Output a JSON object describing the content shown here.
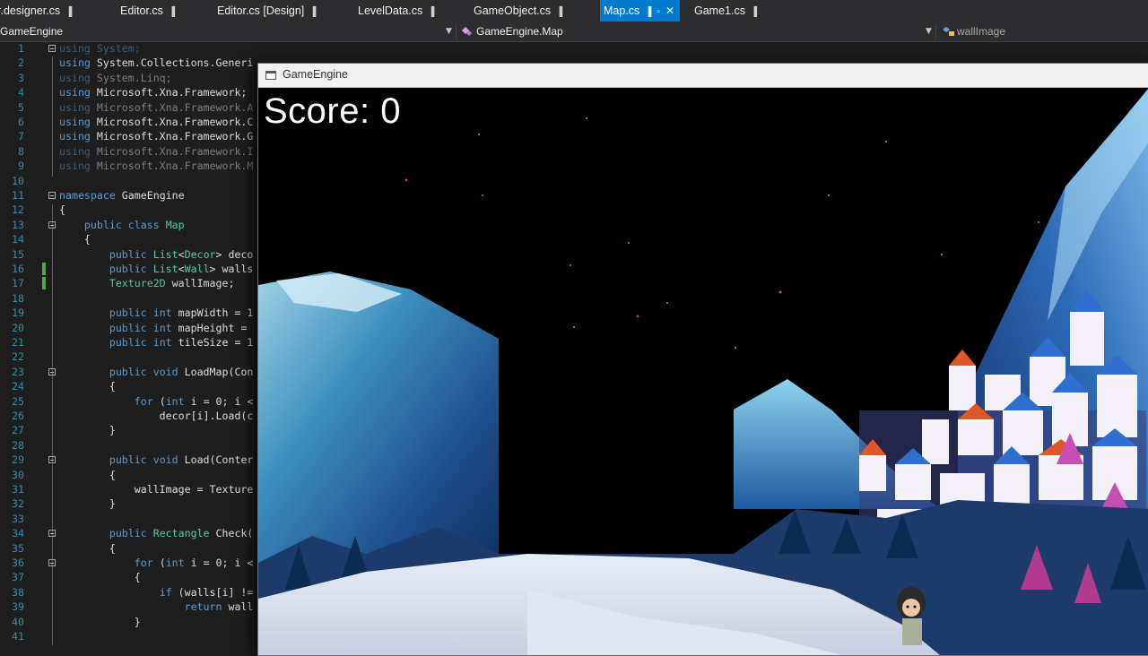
{
  "tabs": [
    {
      "label": "r.designer.cs",
      "pin": "▐"
    },
    {
      "label": "Editor.cs",
      "pin": "▐"
    },
    {
      "label": "Editor.cs [Design]",
      "pin": "▐"
    },
    {
      "label": "LevelData.cs",
      "pin": "▐"
    },
    {
      "label": "GameObject.cs",
      "pin": "▐"
    },
    {
      "label": "Map.cs",
      "pin": "▐"
    },
    {
      "label": "Game1.cs",
      "pin": "▐"
    }
  ],
  "active_tab_icons": {
    "pin": "▐",
    "keep": "▫",
    "close": "✕"
  },
  "nav": {
    "project": "GameEngine",
    "class": "GameEngine.Map",
    "member": "wallImage"
  },
  "code_lines": [
    {
      "n": "1",
      "t": "using System;"
    },
    {
      "n": "2",
      "t": "using System.Collections.Generi"
    },
    {
      "n": "3",
      "t": "using System.Linq;"
    },
    {
      "n": "4",
      "t": "using Microsoft.Xna.Framework;"
    },
    {
      "n": "5",
      "t": "using Microsoft.Xna.Framework.A"
    },
    {
      "n": "6",
      "t": "using Microsoft.Xna.Framework.C"
    },
    {
      "n": "7",
      "t": "using Microsoft.Xna.Framework.G"
    },
    {
      "n": "8",
      "t": "using Microsoft.Xna.Framework.I"
    },
    {
      "n": "9",
      "t": "using Microsoft.Xna.Framework.M"
    },
    {
      "n": "10",
      "t": ""
    },
    {
      "n": "11",
      "t": "namespace GameEngine"
    },
    {
      "n": "12",
      "t": "{"
    },
    {
      "n": "13",
      "t": "    public class Map"
    },
    {
      "n": "14",
      "t": "    {"
    },
    {
      "n": "15",
      "t": "        public List<Decor> deco"
    },
    {
      "n": "16",
      "t": "        public List<Wall> walls"
    },
    {
      "n": "17",
      "t": "        Texture2D wallImage;"
    },
    {
      "n": "18",
      "t": ""
    },
    {
      "n": "19",
      "t": "        public int mapWidth = 1"
    },
    {
      "n": "20",
      "t": "        public int mapHeight ="
    },
    {
      "n": "21",
      "t": "        public int tileSize = 1"
    },
    {
      "n": "22",
      "t": ""
    },
    {
      "n": "23",
      "t": "        public void LoadMap(Con"
    },
    {
      "n": "24",
      "t": "        {"
    },
    {
      "n": "25",
      "t": "            for (int i = 0; i <"
    },
    {
      "n": "26",
      "t": "                decor[i].Load(c"
    },
    {
      "n": "27",
      "t": "        }"
    },
    {
      "n": "28",
      "t": ""
    },
    {
      "n": "29",
      "t": "        public void Load(Conter"
    },
    {
      "n": "30",
      "t": "        {"
    },
    {
      "n": "31",
      "t": "            wallImage = Texture"
    },
    {
      "n": "32",
      "t": "        }"
    },
    {
      "n": "33",
      "t": ""
    },
    {
      "n": "34",
      "t": "        public Rectangle Check("
    },
    {
      "n": "35",
      "t": "        {"
    },
    {
      "n": "36",
      "t": "            for (int i = 0; i <"
    },
    {
      "n": "37",
      "t": "            {"
    },
    {
      "n": "38",
      "t": "                if (walls[i] !="
    },
    {
      "n": "39",
      "t": "                    return wall"
    },
    {
      "n": "40",
      "t": "            }"
    },
    {
      "n": "41",
      "t": ""
    }
  ],
  "game_window": {
    "title": "GameEngine",
    "score_text": "Score: 0"
  },
  "colors": {
    "tab_active": "#007acc",
    "editor_bg": "#1e1e1e",
    "keyword": "#569cd6",
    "type": "#4ec9b0",
    "line_number": "#2b91af"
  }
}
